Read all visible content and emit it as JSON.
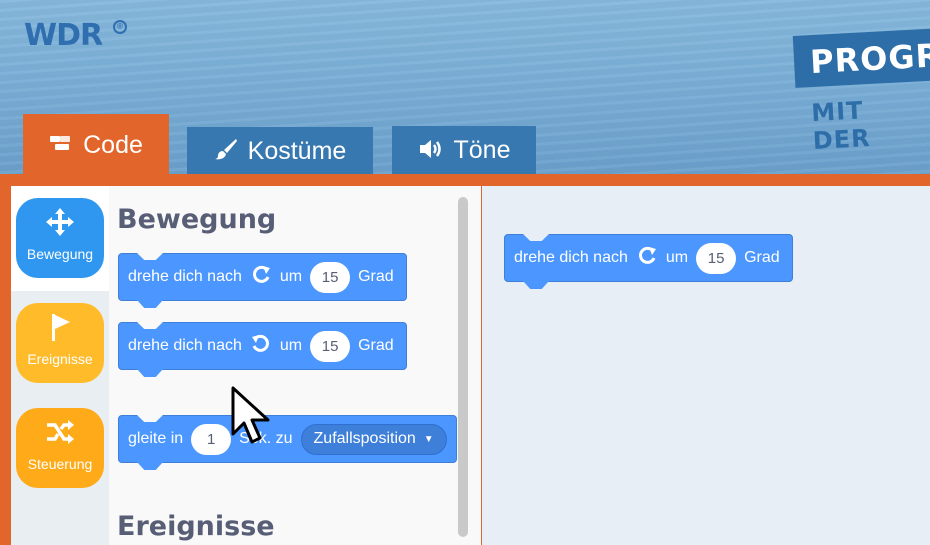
{
  "header": {
    "logo": "WDR",
    "logo_mark": "®",
    "banner_line1": "PROGR",
    "banner_line2": "MIT DER"
  },
  "tabs": [
    {
      "label": "Code",
      "icon": "code-icon"
    },
    {
      "label": "Kostüme",
      "icon": "brush-icon"
    },
    {
      "label": "Töne",
      "icon": "speaker-icon"
    }
  ],
  "categories": [
    {
      "label": "Bewegung",
      "icon": "move-arrows-icon",
      "color": "#2f97ef"
    },
    {
      "label": "Ereignisse",
      "icon": "flag-icon",
      "color": "#ffbb2a"
    },
    {
      "label": "Steuerung",
      "icon": "shuffle-icon",
      "color": "#ffab19"
    }
  ],
  "palette": {
    "heading_motion": "Bewegung",
    "heading_events": "Ereignisse",
    "blocks": [
      {
        "text_a": "drehe dich nach",
        "rot_icon": "rotate-right-icon",
        "text_b": "um",
        "value": "15",
        "text_c": "Grad"
      },
      {
        "text_a": "drehe dich nach",
        "rot_icon": "rotate-left-icon",
        "text_b": "um",
        "value": "15",
        "text_c": "Grad"
      },
      {
        "text_a": "gleite in",
        "value": "1",
        "text_b": "Sek. zu",
        "dropdown": "Zufallsposition"
      }
    ]
  },
  "workspace": {
    "block": {
      "text_a": "drehe dich nach",
      "rot_icon": "rotate-right-icon",
      "text_b": "um",
      "value": "15",
      "text_c": "Grad"
    }
  },
  "colors": {
    "accent_orange": "#e2662c",
    "tab_blue": "#3878b0",
    "block_blue": "#4c97ff"
  }
}
